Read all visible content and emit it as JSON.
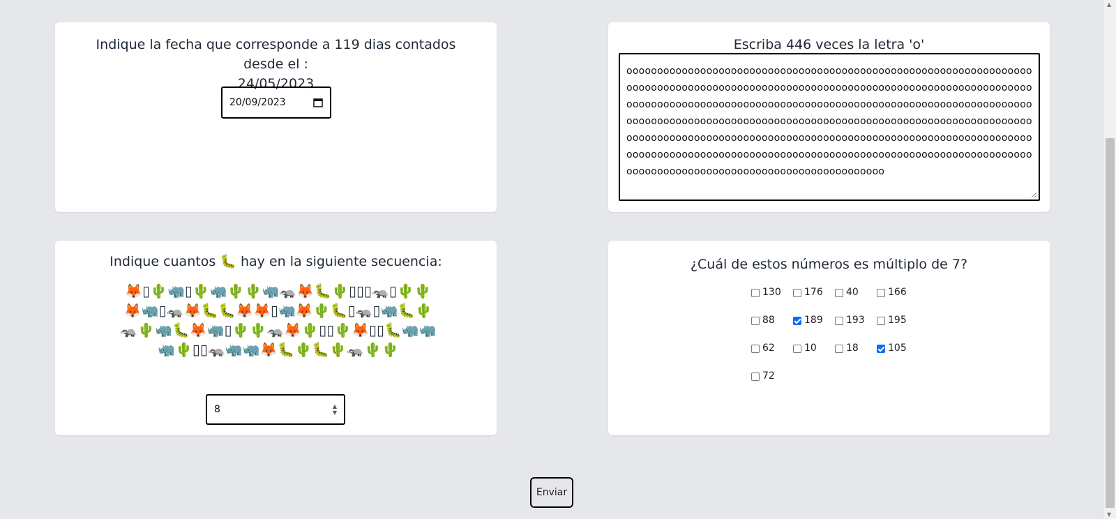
{
  "date_question": {
    "prompt_line1": "Indique la fecha que corresponde a 119 dias contados desde el :",
    "prompt_line2": "24/05/2023",
    "date_value": "20/09/2023"
  },
  "text_question": {
    "prompt": "Escriba 446 veces la letra 'o'",
    "textarea_value": "oooooooooooooooooooooooooooooooooooooooooooooooooooooooooooooooooooooooooooooooooooooooooooooooooooooooooooooooooooooooooooooooooooooooooooooooooooooooooooooooooooooooooooooooooooooooooooooooooooooooooooooooooooooooooooooooooooooooooooooooooooooooooooooooooooooooooooooooooooooooooooooooooooooooooooooooooooooooooooooooooooooooooooooooooooooooooooooooooooooooooooooooooooooooooooooooooooooooooooooooooooooooooooooooooooooooooooooooooooooo"
  },
  "emoji_question": {
    "prompt_before": "Indique cuantos",
    "target_emoji": "🐛",
    "prompt_after": "hay en la siguiente secuencia:",
    "sequence": "🦊▯🌵🦏▯🌵🦏🌵🌵🦏🦡🦊🐛🌵▯▯▯🦡▯🌵🌵🦊🦏▯🦡🦊🐛🐛🦊🦊▯🦏🦊🌵🐛▯🦡▯🦏🐛🌵🦡🌵🦏🐛🦊🦏▯🌵🌵🦡🦊🌵▯▯🌵🦊▯▯🐛🦏🦏🦏🌵▯▯🦡🦏🦏🦊🐛🌵🐛🌵🦡🌵🌵",
    "answer_value": "8"
  },
  "multiple_question": {
    "prompt": "¿Cuál de estos números es múltiplo de 7?",
    "options": [
      {
        "label": "130",
        "checked": false
      },
      {
        "label": "176",
        "checked": false
      },
      {
        "label": "40",
        "checked": false
      },
      {
        "label": "166",
        "checked": false
      },
      {
        "label": "88",
        "checked": false
      },
      {
        "label": "189",
        "checked": true
      },
      {
        "label": "193",
        "checked": false
      },
      {
        "label": "195",
        "checked": false
      },
      {
        "label": "62",
        "checked": false
      },
      {
        "label": "10",
        "checked": false
      },
      {
        "label": "18",
        "checked": false
      },
      {
        "label": "105",
        "checked": true
      },
      {
        "label": "72",
        "checked": false
      }
    ]
  },
  "submit": {
    "label": "Enviar"
  },
  "colors": {
    "background": "#e5e7eb",
    "card": "#ffffff",
    "checkbox_checked": "#0b6ef0"
  }
}
